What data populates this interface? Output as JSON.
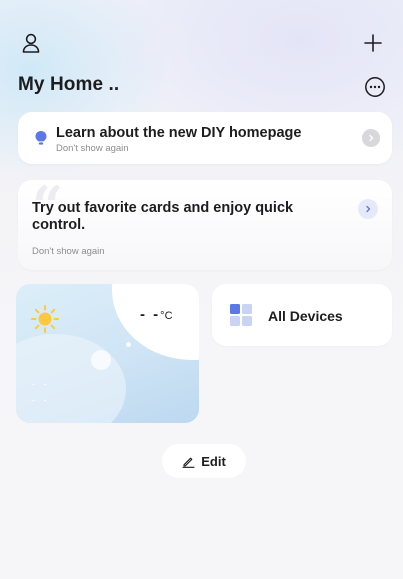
{
  "header": {
    "profile_icon": "person-icon",
    "add_icon": "plus-icon",
    "home_title": "My Home ..",
    "more_icon": "more-horizontal-icon"
  },
  "diy_banner": {
    "icon": "bulb-icon",
    "title": "Learn about the new DIY homepage",
    "dismiss": "Don't show again",
    "chevron_icon": "chevron-right-icon"
  },
  "favorite_banner": {
    "title": "Try out favorite cards and enjoy quick control.",
    "dismiss": "Don't show again",
    "chevron_icon": "chevron-right-icon"
  },
  "weather": {
    "icon": "sun-icon",
    "temperature": "- -",
    "unit": "°C",
    "line1": "- -",
    "line2": "- -"
  },
  "all_devices": {
    "icon": "grid-icon",
    "label": "All Devices"
  },
  "edit": {
    "icon": "pencil-icon",
    "label": "Edit"
  },
  "colors": {
    "accent": "#5a78e6",
    "text": "#1d1d1f",
    "muted": "#8d8d93",
    "card": "#ffffff",
    "weather_bg": "#cfe4f5",
    "sun": "#ffc83d"
  }
}
